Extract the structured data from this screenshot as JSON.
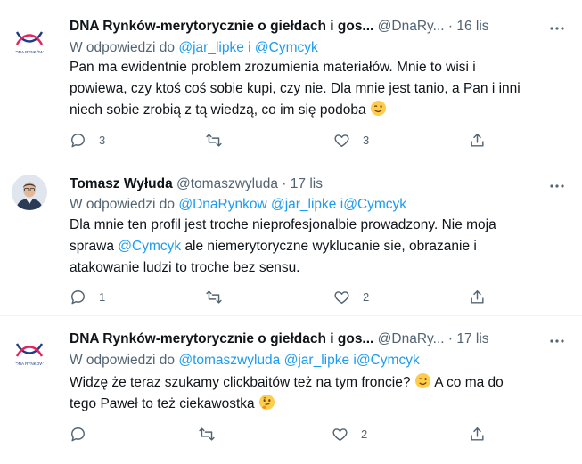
{
  "tweets": [
    {
      "name": "DNA Rynków-merytorycznie o giełdach i gos...",
      "handle": "@DnaRy...",
      "date": "16 lis",
      "reply_prefix": "W odpowiedzi do",
      "reply_to_1": "@jar_lipke",
      "reply_sep_1": "i",
      "reply_to_2": "@Cymcyk",
      "text_line_1": "Pan ma ewidentnie problem zrozumienia materiałów. Mnie to wisi i",
      "text_line_2": "powiewa, czy ktoś coś sobie kupi, czy nie. Dla mnie jest tanio, a Pan i inni",
      "text_line_3": "niech sobie zrobią z tą wiedzą, co im się podoba",
      "replies": "3",
      "retweets": "",
      "likes": "3",
      "avatar_text": "DNA RYNKÓW"
    },
    {
      "name": "Tomasz Wyłuda",
      "handle": "@tomaszwyluda",
      "date": "17 lis",
      "reply_prefix": "W odpowiedzi do",
      "reply_to_1": "@DnaRynkow",
      "reply_to_2": "@jar_lipke",
      "reply_sep": "i",
      "reply_to_3": "@Cymcyk",
      "text_line_1": "Dla mnie ten profil jest troche nieprofesjonalbie prowadzony. Nie moja",
      "text_line_2_pre": "sprawa",
      "text_line_2_link": "@Cymcyk",
      "text_line_2_post": "ale niemerytoryczne wyklucanie sie, obrazanie i",
      "text_line_3": "atakowanie ludzi to troche bez sensu.",
      "replies": "1",
      "retweets": "",
      "likes": "2"
    },
    {
      "name": "DNA Rynków-merytorycznie o giełdach i gos...",
      "handle": "@DnaRy...",
      "date": "17 lis",
      "reply_prefix": "W odpowiedzi do",
      "reply_to_1": "@tomaszwyluda",
      "reply_to_2": "@jar_lipke",
      "reply_sep": "i",
      "reply_to_3": "@Cymcyk",
      "text_line_1_pre": "Widzę że teraz szukamy clickbaitów też na tym froncie?",
      "text_line_1_post": "A co ma do",
      "text_line_2": "tego Paweł to też ciekawostka",
      "replies": "",
      "retweets": "",
      "likes": "2",
      "avatar_text": "DNA RYNKÓW"
    }
  ],
  "separator": "·",
  "icons": {
    "reply": "reply-icon",
    "retweet": "retweet-icon",
    "like": "heart-icon",
    "share": "share-icon",
    "more": "more-icon"
  },
  "colors": {
    "link": "#1d9bf0",
    "muted": "#536471",
    "text": "#0f1419",
    "brand": "#1e3a8a",
    "brand_red": "#e0245e"
  }
}
